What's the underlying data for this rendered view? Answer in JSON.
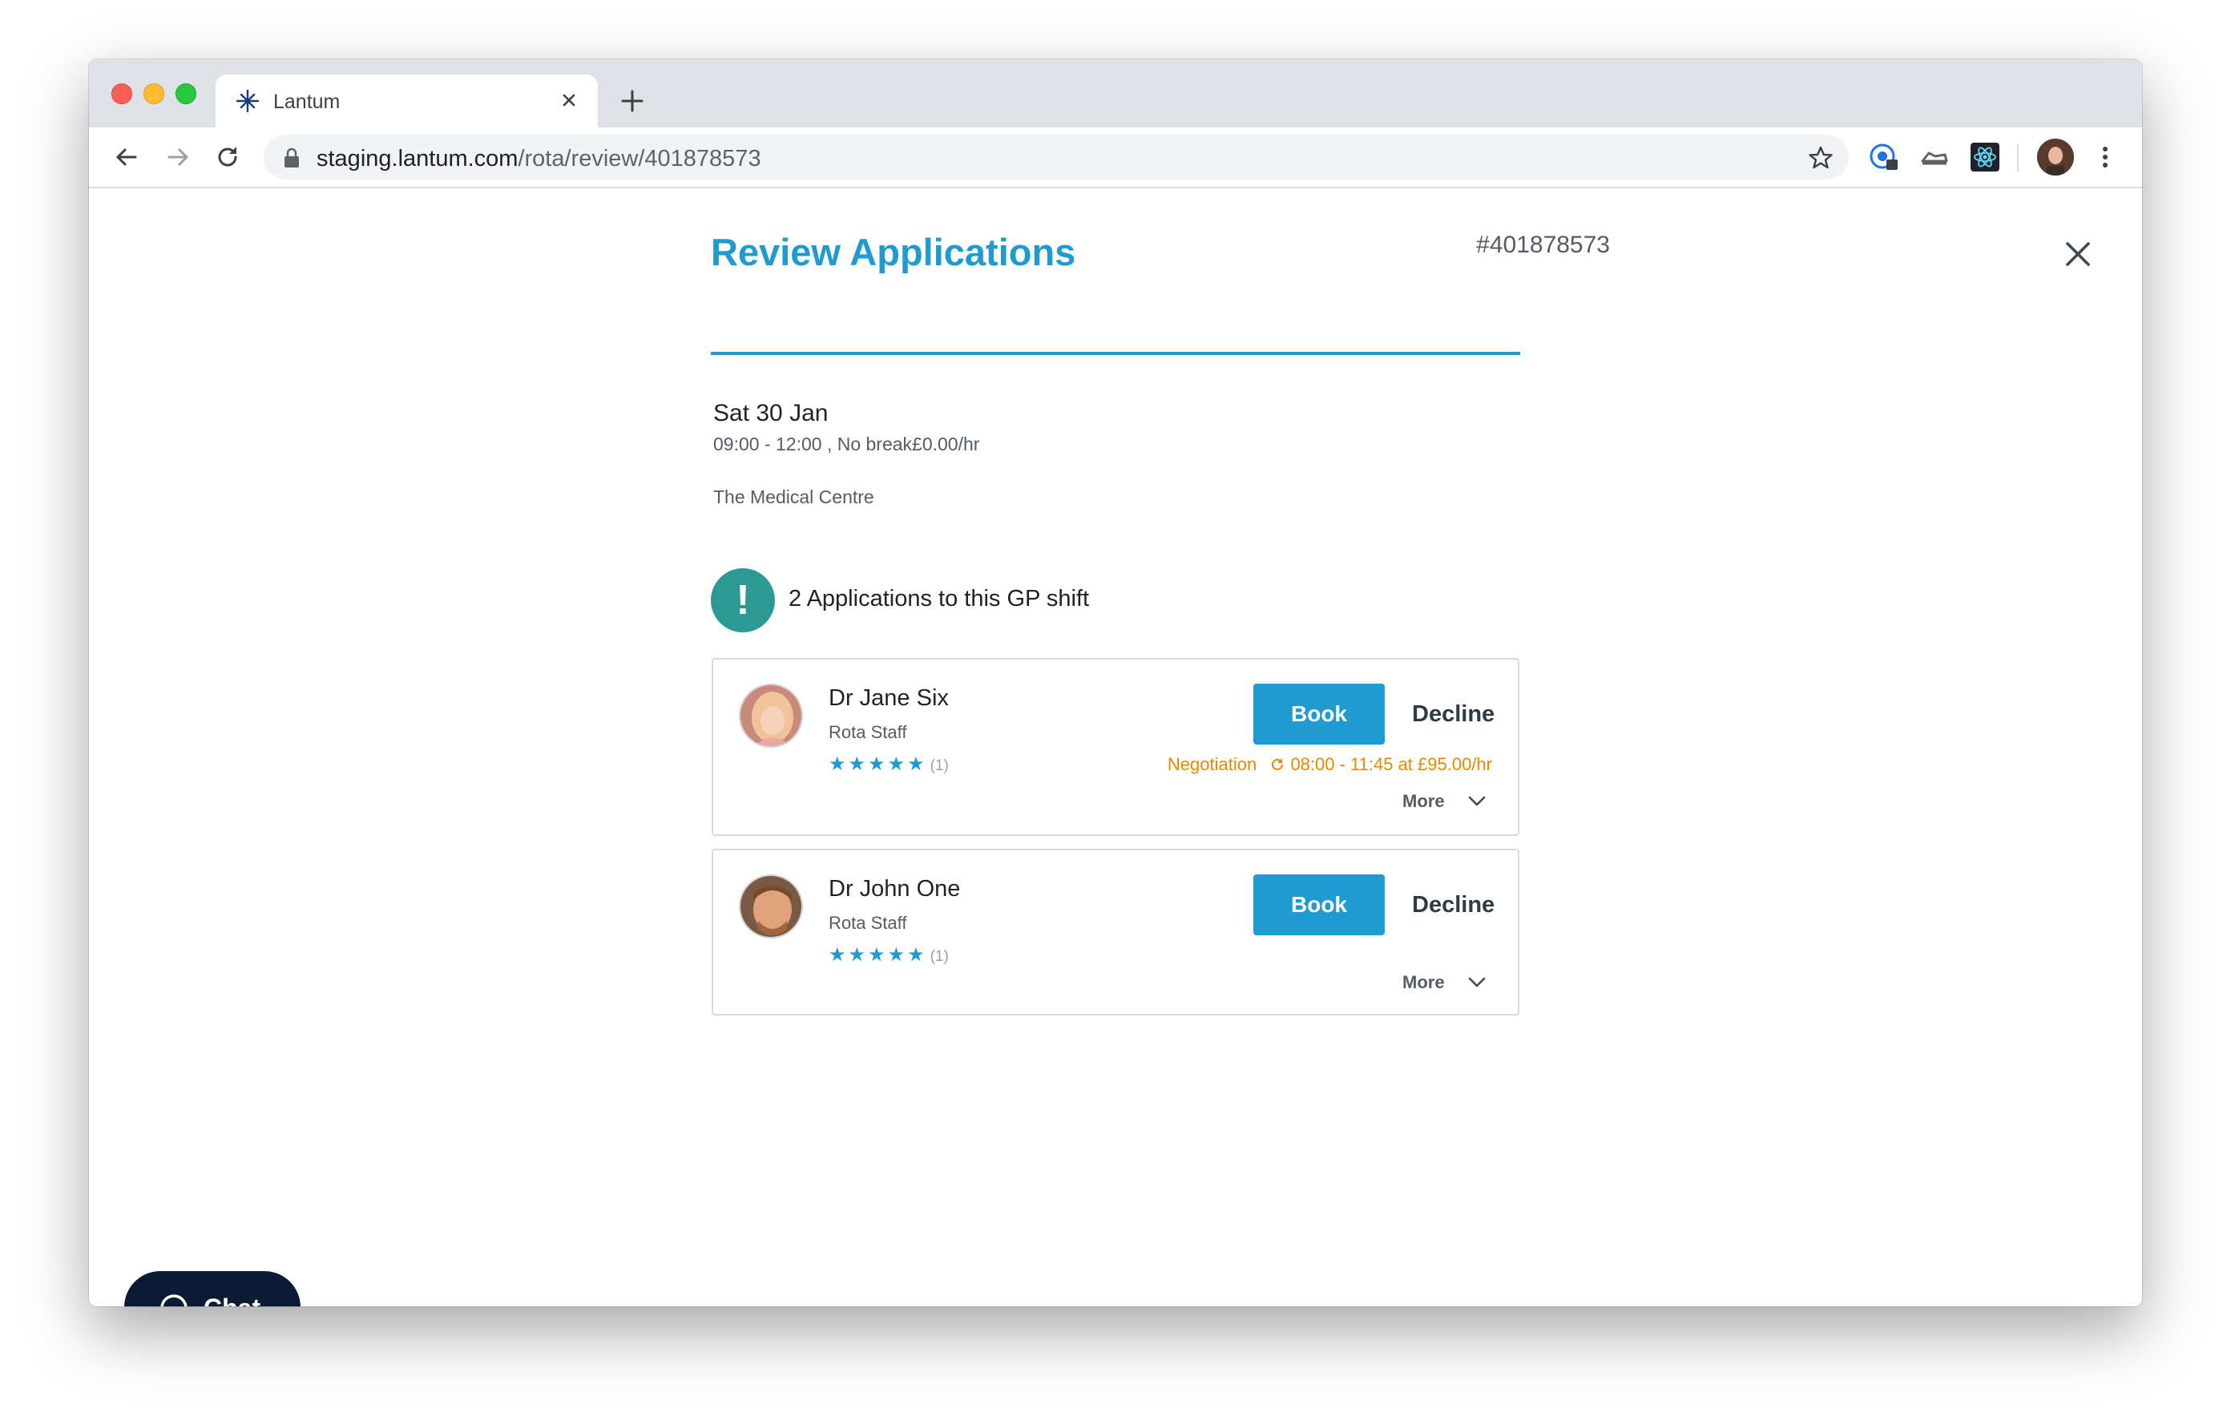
{
  "browser": {
    "tab_title": "Lantum",
    "url_host": "staging.lantum.com",
    "url_path": "/rota/review/401878573"
  },
  "review": {
    "title": "Review Applications",
    "shift_id": "#401878573",
    "date": "Sat 30 Jan",
    "time": "09:00 - 12:00 , No break£0.00/hr",
    "location": "The Medical Centre",
    "alert_symbol": "!",
    "applications_text": "2 Applications to this GP shift"
  },
  "applicants": [
    {
      "name": "Dr Jane Six",
      "role": "Rota Staff",
      "rating": 5,
      "stars": "★★★★★",
      "rating_count": "(1)",
      "book_label": "Book",
      "decline_label": "Decline",
      "negotiation_label": "Negotiation",
      "negotiation_value": "08:00 - 11:45 at £95.00/hr",
      "more_label": "More"
    },
    {
      "name": "Dr John One",
      "role": "Rota Staff",
      "rating": 5,
      "stars": "★★★★★",
      "rating_count": "(1)",
      "book_label": "Book",
      "decline_label": "Decline",
      "more_label": "More"
    }
  ],
  "chat": {
    "label": "Chat"
  },
  "colors": {
    "accent": "#1f9bd2",
    "alert": "#2c9a93",
    "negotiation": "#e58a00",
    "chat_bg": "#0a1b33"
  }
}
